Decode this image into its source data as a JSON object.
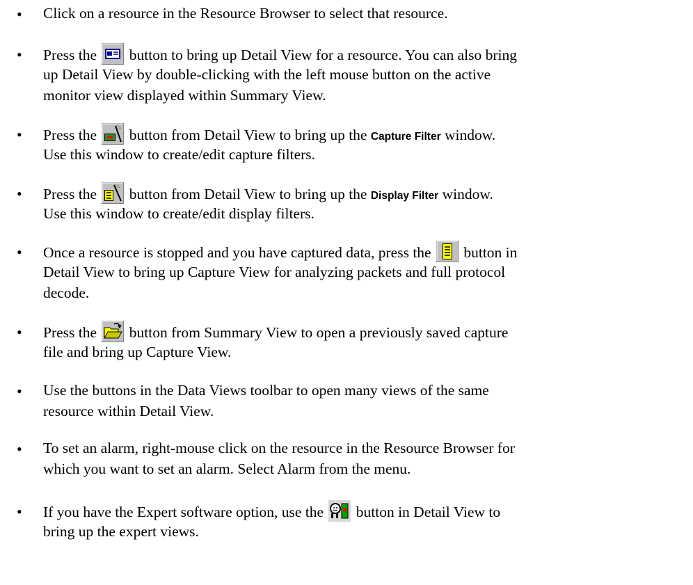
{
  "bullet_glyph": "•",
  "items": [
    {
      "lines": [
        {
          "pre": "Click on a resource in the Resource Browser to select that resource."
        }
      ]
    },
    {
      "icon": "detail-view-icon",
      "lines": [
        {
          "pre": "Press the",
          "post": "button to bring up Detail View for a resource. You can also bring"
        },
        {
          "pre": "up Detail View by double-clicking with the left mouse button on the active"
        },
        {
          "pre": "monitor view displayed within Summary View."
        }
      ]
    },
    {
      "icon": "capture-filter-icon",
      "lines": [
        {
          "pre": "Press the",
          "post": "button from Detail View to bring up the",
          "term": "Capture Filter",
          "after": "window."
        },
        {
          "pre": "Use this window to create/edit capture filters."
        }
      ]
    },
    {
      "icon": "display-filter-icon",
      "lines": [
        {
          "pre": "Press the",
          "post": "button from Detail View to bring up the",
          "term": "Display Filter",
          "after": "window."
        },
        {
          "pre": "Use this window to create/edit display filters."
        }
      ]
    },
    {
      "icon": "capture-view-icon",
      "lines": [
        {
          "pre": "Once a resource is stopped and you have captured data, press the",
          "post": "button in"
        },
        {
          "pre": "Detail View to bring up Capture View for analyzing packets and full protocol"
        },
        {
          "pre": "decode."
        }
      ]
    },
    {
      "icon": "open-file-icon",
      "lines": [
        {
          "pre": "Press the",
          "post": "button from Summary View to open a previously saved capture"
        },
        {
          "pre": "file and bring up Capture View."
        }
      ]
    },
    {
      "lines": [
        {
          "pre": "Use the buttons in the Data Views toolbar to open many views of the same"
        },
        {
          "pre": "resource within Detail View."
        }
      ]
    },
    {
      "lines": [
        {
          "pre": "To set an alarm, right-mouse click on the resource in the Resource Browser for"
        },
        {
          "pre": "which you want to set an alarm. Select Alarm from the menu."
        }
      ]
    },
    {
      "icon": "expert-icon",
      "lines": [
        {
          "pre": "If you have the Expert software option, use the",
          "post": "button in Detail View to"
        },
        {
          "pre": "bring up the expert views."
        }
      ]
    }
  ]
}
